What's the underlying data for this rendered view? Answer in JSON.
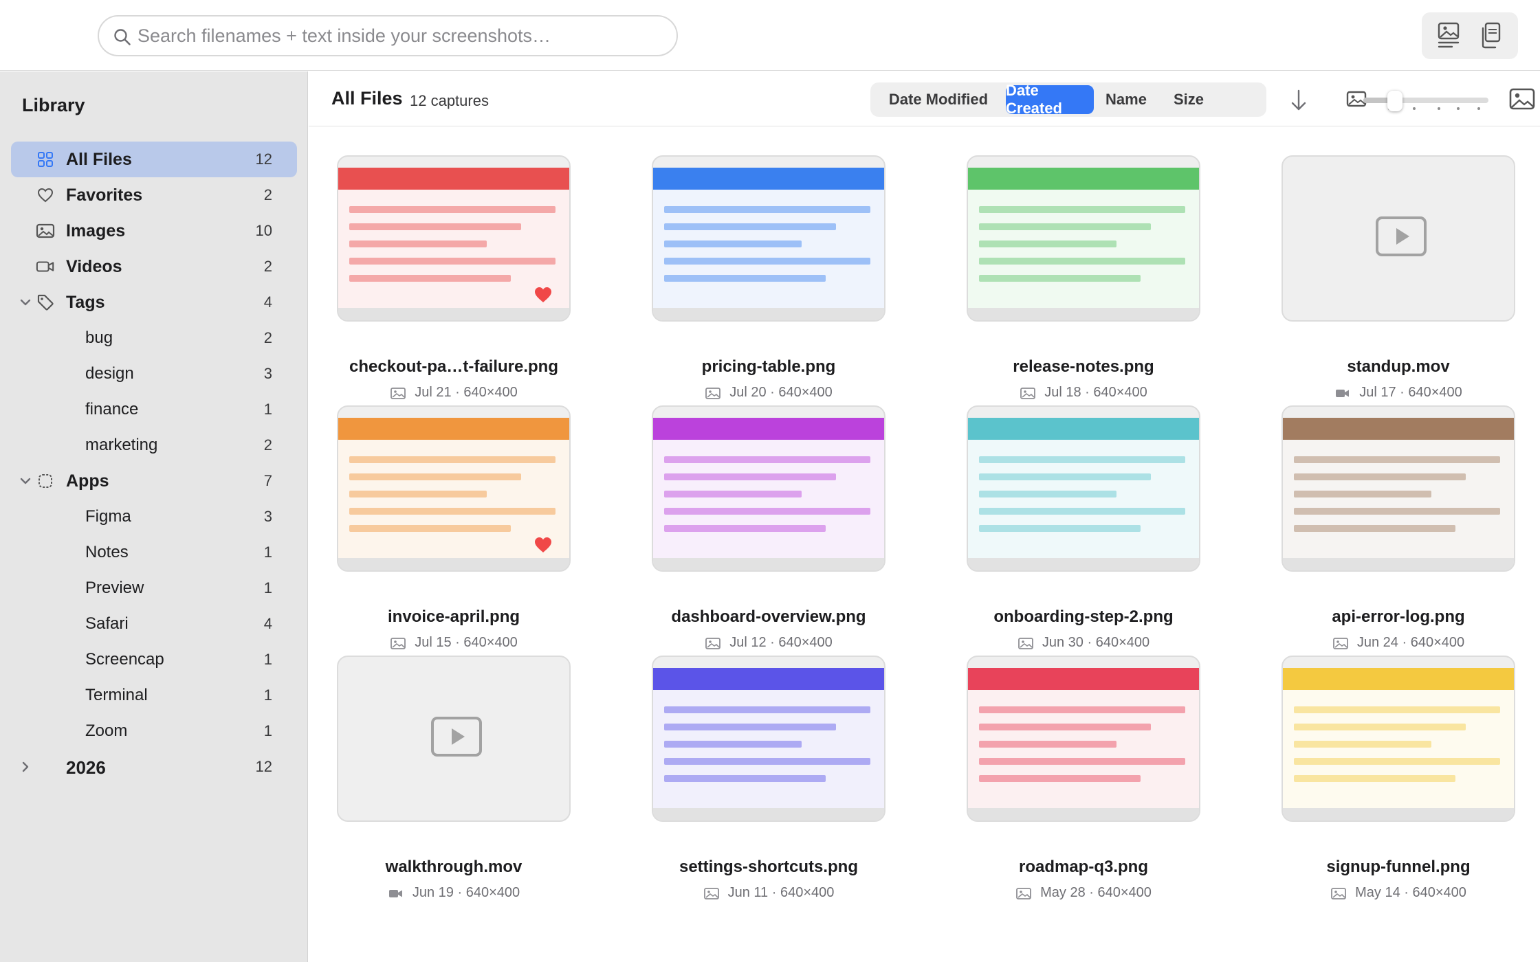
{
  "search": {
    "placeholder": "Search filenames + text inside your screenshots…",
    "value": ""
  },
  "sidebar": {
    "title": "Library",
    "items": [
      {
        "label": "All Files",
        "count": "12",
        "icon": "grid-icon",
        "selected": true,
        "level": 0,
        "chevron": ""
      },
      {
        "label": "Favorites",
        "count": "2",
        "icon": "heart-outline-icon",
        "level": 0,
        "chevron": ""
      },
      {
        "label": "Images",
        "count": "10",
        "icon": "image-icon",
        "level": 0,
        "chevron": ""
      },
      {
        "label": "Videos",
        "count": "2",
        "icon": "video-camera-icon",
        "level": 0,
        "chevron": ""
      },
      {
        "label": "Tags",
        "count": "4",
        "icon": "tag-icon",
        "level": 0,
        "chevron": "down"
      },
      {
        "label": "bug",
        "count": "2",
        "level": 1
      },
      {
        "label": "design",
        "count": "3",
        "level": 1
      },
      {
        "label": "finance",
        "count": "1",
        "level": 1
      },
      {
        "label": "marketing",
        "count": "2",
        "level": 1
      },
      {
        "label": "Apps",
        "count": "7",
        "icon": "app-square-icon",
        "level": 0,
        "chevron": "down"
      },
      {
        "label": "Figma",
        "count": "3",
        "level": 1
      },
      {
        "label": "Notes",
        "count": "1",
        "level": 1
      },
      {
        "label": "Preview",
        "count": "1",
        "level": 1
      },
      {
        "label": "Safari",
        "count": "4",
        "level": 1
      },
      {
        "label": "Screencap",
        "count": "1",
        "level": 1
      },
      {
        "label": "Terminal",
        "count": "1",
        "level": 1
      },
      {
        "label": "Zoom",
        "count": "1",
        "level": 1
      },
      {
        "label": "2026",
        "count": "12",
        "level": 0,
        "chevron": "right",
        "big": true
      }
    ]
  },
  "header": {
    "title": "All Files",
    "count_label": "12 captures",
    "sort_options": [
      "Date Modified",
      "Date Created",
      "Name",
      "Size"
    ],
    "active_sort": "Date Created",
    "sort_direction": "descending",
    "zoom_level": 0.25
  },
  "colors": {
    "accent": "#3478f6",
    "selected_row": "#b9c9ea",
    "favorite_heart": "#f04848"
  },
  "files": [
    {
      "name": "checkout-pa…t-failure.png",
      "meta": "Jul 21 · 640×400",
      "type": "image",
      "color": "#e85050",
      "tint": "#fdf0f0",
      "favorite": true
    },
    {
      "name": "pricing-table.png",
      "meta": "Jul 20 · 640×400",
      "type": "image",
      "color": "#3a80ef",
      "tint": "#eff4fd",
      "favorite": false
    },
    {
      "name": "release-notes.png",
      "meta": "Jul 18 · 640×400",
      "type": "image",
      "color": "#5ec46a",
      "tint": "#f0faf1",
      "favorite": false
    },
    {
      "name": "standup.mov",
      "meta": "Jul 17 · 640×400",
      "type": "video",
      "favorite": false
    },
    {
      "name": "invoice-april.png",
      "meta": "Jul 15 · 640×400",
      "type": "image",
      "color": "#f0963e",
      "tint": "#fdf5ec",
      "favorite": true
    },
    {
      "name": "dashboard-overview.png",
      "meta": "Jul 12 · 640×400",
      "type": "image",
      "color": "#bb42dc",
      "tint": "#f8effc",
      "favorite": false
    },
    {
      "name": "onboarding-step-2.png",
      "meta": "Jun 30 · 640×400",
      "type": "image",
      "color": "#5bc3cc",
      "tint": "#eff9fa",
      "favorite": false
    },
    {
      "name": "api-error-log.png",
      "meta": "Jun 24 · 640×400",
      "type": "image",
      "color": "#a27c60",
      "tint": "#f6f4f2",
      "favorite": false
    },
    {
      "name": "walkthrough.mov",
      "meta": "Jun 19 · 640×400",
      "type": "video",
      "favorite": false
    },
    {
      "name": "settings-shortcuts.png",
      "meta": "Jun 11 · 640×400",
      "type": "image",
      "color": "#5b54e8",
      "tint": "#f1f0fc",
      "favorite": false
    },
    {
      "name": "roadmap-q3.png",
      "meta": "May 28 · 640×400",
      "type": "image",
      "color": "#e8435a",
      "tint": "#fcf0f1",
      "favorite": false
    },
    {
      "name": "signup-funnel.png",
      "meta": "May 14 · 640×400",
      "type": "image",
      "color": "#f4c940",
      "tint": "#fefbef",
      "favorite": false
    }
  ]
}
